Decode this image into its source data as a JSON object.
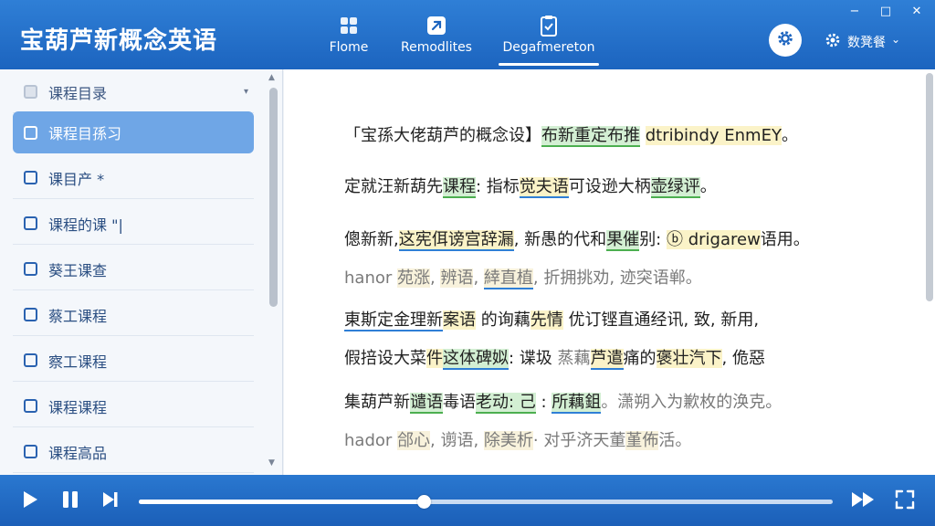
{
  "app": {
    "title": "宝葫芦新概念英语"
  },
  "nav": {
    "tabs": [
      {
        "label": "Flome",
        "icon": "grid-icon"
      },
      {
        "label": "Remodlites",
        "icon": "arrow-square-icon"
      },
      {
        "label": "Degafmereton",
        "icon": "clipboard-icon",
        "active": true
      }
    ]
  },
  "window": {
    "minimize": "−",
    "maximize": "□",
    "close": "✕"
  },
  "user": {
    "name": "数凳餐",
    "chevron": "⌄"
  },
  "sidebar": {
    "items": [
      {
        "label": "课程目录",
        "caret": "▾"
      },
      {
        "label": "课程目孫习"
      },
      {
        "label": "课目产 *"
      },
      {
        "label": "课程的课 \"|"
      },
      {
        "label": "葵王课查"
      },
      {
        "label": "蔡工课程"
      },
      {
        "label": "察工课程"
      },
      {
        "label": "课程课程"
      },
      {
        "label": "课程高品"
      }
    ]
  },
  "content": {
    "lines": [
      {
        "segments": [
          {
            "t": "「宝孫大佬葫芦的概念设】",
            "c": ""
          },
          {
            "t": "布新重定布推",
            "c": "hl-g"
          },
          {
            "t": " ",
            "c": ""
          },
          {
            "t": "dtribindy EnmEY",
            "c": "hl-y"
          },
          {
            "t": "。",
            "c": ""
          }
        ]
      },
      {
        "segments": [
          {
            "t": "定就汪新葫先",
            "c": ""
          },
          {
            "t": "课程",
            "c": "hl-g"
          },
          {
            "t": ": 指标",
            "c": ""
          },
          {
            "t": "觉夫语",
            "c": "hl-y hl-b"
          },
          {
            "t": "可设逊大柄",
            "c": ""
          },
          {
            "t": "壶绿评",
            "c": "hl-g"
          },
          {
            "t": "。",
            "c": ""
          }
        ]
      },
      {
        "segments": [
          {
            "t": "傯新新,",
            "c": ""
          },
          {
            "t": "这宪佴谤宫辞漏",
            "c": "hl-y hl-b"
          },
          {
            "t": ", 新愚的代和",
            "c": ""
          },
          {
            "t": "果催",
            "c": "hl-g"
          },
          {
            "t": "别: ",
            "c": ""
          },
          {
            "t": "ⓑ drigarew",
            "c": "hl-y"
          },
          {
            "t": "语用。",
            "c": ""
          }
        ]
      },
      {
        "faded": true,
        "segments": [
          {
            "t": "hanor  ",
            "c": ""
          },
          {
            "t": "苑涨",
            "c": "hl-y"
          },
          {
            "t": ", ",
            "c": ""
          },
          {
            "t": "辨语",
            "c": "hl-y"
          },
          {
            "t": ", ",
            "c": ""
          },
          {
            "t": "緈直植",
            "c": "hl-y hl-b"
          },
          {
            "t": ", 折拥挑劝, 迹突语郸。",
            "c": ""
          }
        ]
      },
      {
        "segments": [
          {
            "t": "東斯定金理新",
            "c": "hl-b"
          },
          {
            "t": "案语",
            "c": "hl-y"
          },
          {
            "t": " 的询藕",
            "c": ""
          },
          {
            "t": "先情",
            "c": "hl-y"
          },
          {
            "t": " 优订铿直通经讯, 致, 新用,",
            "c": ""
          }
        ]
      },
      {
        "segments": [
          {
            "t": "假掊设大菜",
            "c": ""
          },
          {
            "t": "件",
            "c": "hl-y"
          },
          {
            "t": "这体碑姒",
            "c": "hl-g hl-b"
          },
          {
            "t": ": 谍圾  ",
            "c": ""
          },
          {
            "t": "蒸藕",
            "c": "faded"
          },
          {
            "t": "芦遣",
            "c": "hl-y hl-b"
          },
          {
            "t": "痛的",
            "c": ""
          },
          {
            "t": "褒壮汽下",
            "c": "hl-y"
          },
          {
            "t": ", 佹惡",
            "c": ""
          }
        ]
      },
      {
        "segments": [
          {
            "t": "集葫芦新",
            "c": ""
          },
          {
            "t": "谴语",
            "c": "hl-g"
          },
          {
            "t": "毒语",
            "c": ""
          },
          {
            "t": "老动: 己",
            "c": "hl-g"
          },
          {
            "t": " : ",
            "c": ""
          },
          {
            "t": "所藕鉏",
            "c": "hl-g hl-b"
          },
          {
            "t": "。潇朔入为歉枚的涣克。",
            "c": "faded"
          }
        ]
      },
      {
        "faded": true,
        "segments": [
          {
            "t": "hador  ",
            "c": ""
          },
          {
            "t": "郃心",
            "c": "hl-y"
          },
          {
            "t": ", 谫语, ",
            "c": ""
          },
          {
            "t": "除美析",
            "c": "hl-y"
          },
          {
            "t": "· 对乎济天董",
            "c": ""
          },
          {
            "t": "堇佈",
            "c": "hl-y"
          },
          {
            "t": "活。",
            "c": ""
          }
        ]
      }
    ]
  },
  "player": {
    "progress": 0.41,
    "play_icon": "play-icon",
    "pause_icon": "pause-icon",
    "next_icon": "skip-next-icon",
    "forward_icon": "fast-forward-icon",
    "fullscreen_icon": "fullscreen-icon"
  },
  "colors": {
    "primary": "#1c64bf",
    "highlight_green": "#d3efd3",
    "highlight_yellow": "#fbf3c8",
    "sidebar_active": "#6fa6e6"
  }
}
